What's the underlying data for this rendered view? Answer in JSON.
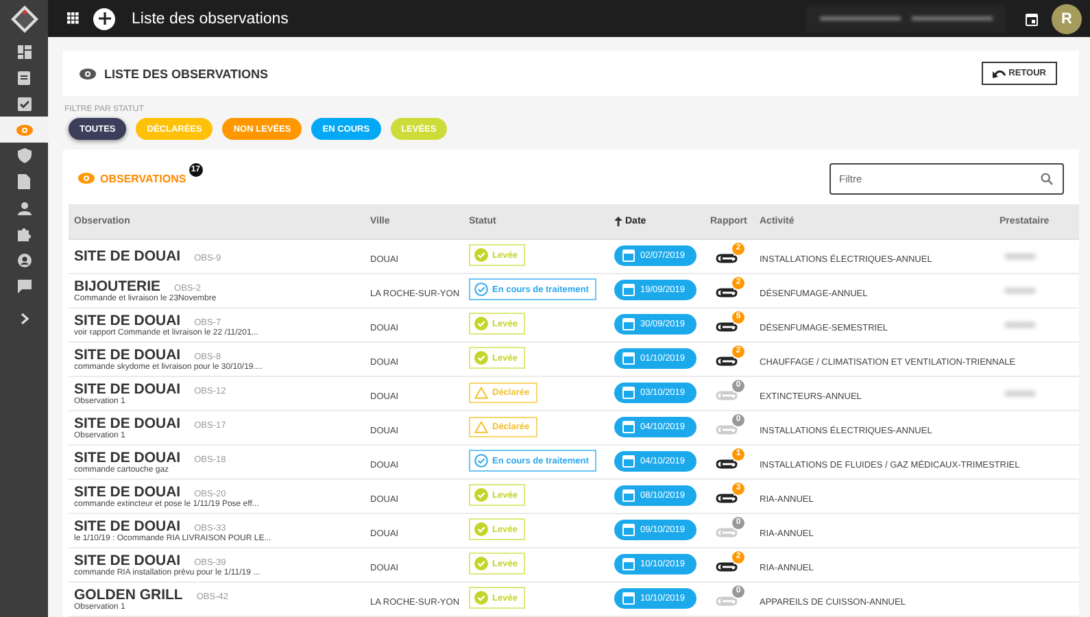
{
  "topbar": {
    "title": "Liste des observations",
    "avatar": "R"
  },
  "sidebar": {
    "items": [
      {
        "kind": "dashboard",
        "selected": false
      },
      {
        "kind": "clipboard",
        "selected": false
      },
      {
        "kind": "check",
        "selected": false
      },
      {
        "kind": "eye",
        "selected": true
      },
      {
        "kind": "shield",
        "selected": false
      },
      {
        "kind": "document",
        "selected": false
      },
      {
        "kind": "person",
        "selected": false
      },
      {
        "kind": "puzzle",
        "selected": false
      },
      {
        "kind": "account",
        "selected": false
      },
      {
        "kind": "chat",
        "selected": false
      }
    ]
  },
  "header": {
    "title": "LISTE DES OBSERVATIONS",
    "back_button": "RETOUR"
  },
  "filter": {
    "label": "FILTRE PAR STATUT",
    "chips": [
      {
        "label": "TOUTES",
        "color": "#3b3f5c",
        "selected": true
      },
      {
        "label": "DÉCLARÉES",
        "color": "#ffc107",
        "selected": false
      },
      {
        "label": "NON LEVÉES",
        "color": "#ff9800",
        "selected": false
      },
      {
        "label": "EN COURS",
        "color": "#03a9f4",
        "selected": false
      },
      {
        "label": "LEVÉES",
        "color": "#cddc39",
        "selected": false
      }
    ]
  },
  "observations": {
    "title": "OBSERVATIONS",
    "count": "17",
    "search": {
      "placeholder": "Filtre"
    },
    "columns": [
      "Observation",
      "Ville",
      "Statut",
      "Date",
      "Rapport",
      "Activité",
      "Prestataire"
    ],
    "rows": [
      {
        "site": "SITE DE DOUAI",
        "code": "OBS-9",
        "ville": "DOUAI",
        "status": {
          "kind": "levee",
          "label": "Levée"
        },
        "date": "02/07/2019",
        "rapport": {
          "count": "2",
          "empty": false
        },
        "activite": "INSTALLATIONS ÉLECTRIQUES-ANNUEL",
        "prestataire_blurred": true
      },
      {
        "site": "BIJOUTERIE",
        "code": "OBS-2",
        "description": "Commande et livraison le 23Novembre",
        "ville": "LA ROCHE-SUR-YON",
        "status": {
          "kind": "en_cours",
          "label": "En cours de traitement"
        },
        "date": "19/09/2019",
        "rapport": {
          "count": "2",
          "empty": false
        },
        "activite": "DÉSENFUMAGE-ANNUEL",
        "prestataire_blurred": true
      },
      {
        "site": "SITE DE DOUAI",
        "code": "OBS-7",
        "description": "voir rapport Commande et livraison le 22 /11/201...",
        "ville": "DOUAI",
        "status": {
          "kind": "levee",
          "label": "Levée"
        },
        "date": "30/09/2019",
        "rapport": {
          "count": "5",
          "empty": false
        },
        "activite": "DÉSENFUMAGE-SEMESTRIEL",
        "prestataire_blurred": true
      },
      {
        "site": "SITE DE DOUAI",
        "code": "OBS-8",
        "description": "commande skydome et livraison pour le 30/10/19....",
        "ville": "DOUAI",
        "status": {
          "kind": "levee",
          "label": "Levée"
        },
        "date": "01/10/2019",
        "rapport": {
          "count": "2",
          "empty": false
        },
        "activite": "CHAUFFAGE / CLIMATISATION ET VENTILATION-TRIENNALE"
      },
      {
        "site": "SITE DE DOUAI",
        "code": "OBS-12",
        "description": "Observation 1",
        "ville": "DOUAI",
        "status": {
          "kind": "declaree",
          "label": "Déclarée"
        },
        "date": "03/10/2019",
        "rapport": {
          "count": "0",
          "empty": true
        },
        "activite": "EXTINCTEURS-ANNUEL",
        "prestataire_blurred": true
      },
      {
        "site": "SITE DE DOUAI",
        "code": "OBS-17",
        "description": "Observation 1",
        "ville": "DOUAI",
        "status": {
          "kind": "declaree",
          "label": "Déclarée"
        },
        "date": "04/10/2019",
        "rapport": {
          "count": "0",
          "empty": true
        },
        "activite": "INSTALLATIONS ÉLECTRIQUES-ANNUEL"
      },
      {
        "site": "SITE DE DOUAI",
        "code": "OBS-18",
        "description": "commande cartouche gaz",
        "ville": "DOUAI",
        "status": {
          "kind": "en_cours",
          "label": "En cours de traitement"
        },
        "date": "04/10/2019",
        "rapport": {
          "count": "1",
          "empty": false
        },
        "activite": "INSTALLATIONS DE FLUIDES / GAZ MÉDICAUX-TRIMESTRIEL"
      },
      {
        "site": "SITE DE DOUAI",
        "code": "OBS-20",
        "description": "commande extincteur et pose le 1/11/19 Pose eff...",
        "ville": "DOUAI",
        "status": {
          "kind": "levee",
          "label": "Levée"
        },
        "date": "08/10/2019",
        "rapport": {
          "count": "3",
          "empty": false
        },
        "activite": "RIA-ANNUEL"
      },
      {
        "site": "SITE DE DOUAI",
        "code": "OBS-33",
        "description": "le 1/10/19 : Ocommande RIA LIVRAISON POUR LE...",
        "ville": "DOUAI",
        "status": {
          "kind": "levee",
          "label": "Levée"
        },
        "date": "09/10/2019",
        "rapport": {
          "count": "0",
          "empty": true
        },
        "activite": "RIA-ANNUEL"
      },
      {
        "site": "SITE DE DOUAI",
        "code": "OBS-39",
        "description": "commande RIA installation prévu pour le 1/11/19 ...",
        "ville": "DOUAI",
        "status": {
          "kind": "levee",
          "label": "Levée"
        },
        "date": "10/10/2019",
        "rapport": {
          "count": "2",
          "empty": false
        },
        "activite": "RIA-ANNUEL"
      },
      {
        "site": "GOLDEN GRILL",
        "code": "OBS-42",
        "description": "Observation 1",
        "ville": "LA ROCHE-SUR-YON",
        "status": {
          "kind": "levee",
          "label": "Levée"
        },
        "date": "10/10/2019",
        "rapport": {
          "count": "0",
          "empty": true
        },
        "activite": "APPAREILS DE CUISSON-ANNUEL"
      }
    ]
  }
}
